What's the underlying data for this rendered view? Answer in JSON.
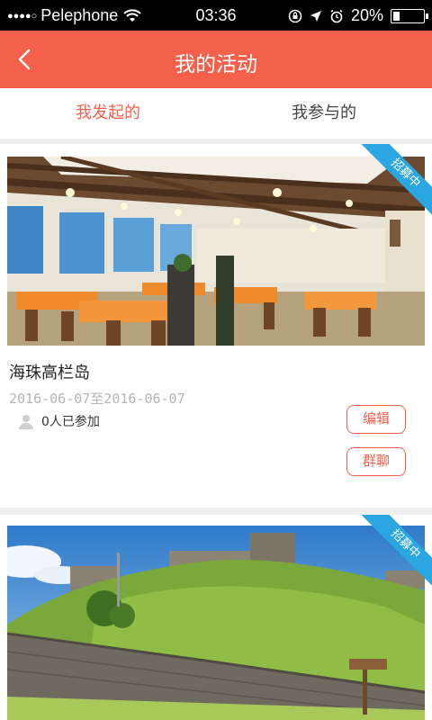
{
  "status": {
    "carrier": "Pelephone",
    "signal": "●●●●○",
    "time": "03:36",
    "battery": "20%",
    "battery_level": 0.2
  },
  "nav": {
    "title": "我的活动"
  },
  "tabs": [
    {
      "label": "我发起的",
      "active": true
    },
    {
      "label": "我参与的",
      "active": false
    }
  ],
  "activities": [
    {
      "badge": "招募中",
      "title": "海珠高栏岛",
      "date": "2016-06-07至2016-06-07",
      "participants": "0人已参加",
      "edit_label": "编辑",
      "chat_label": "群聊",
      "image": "restaurant-interior"
    },
    {
      "badge": "招募中",
      "image": "hill-fortress"
    }
  ],
  "colors": {
    "accent": "#f5604a",
    "badge": "#2aa7e0"
  }
}
